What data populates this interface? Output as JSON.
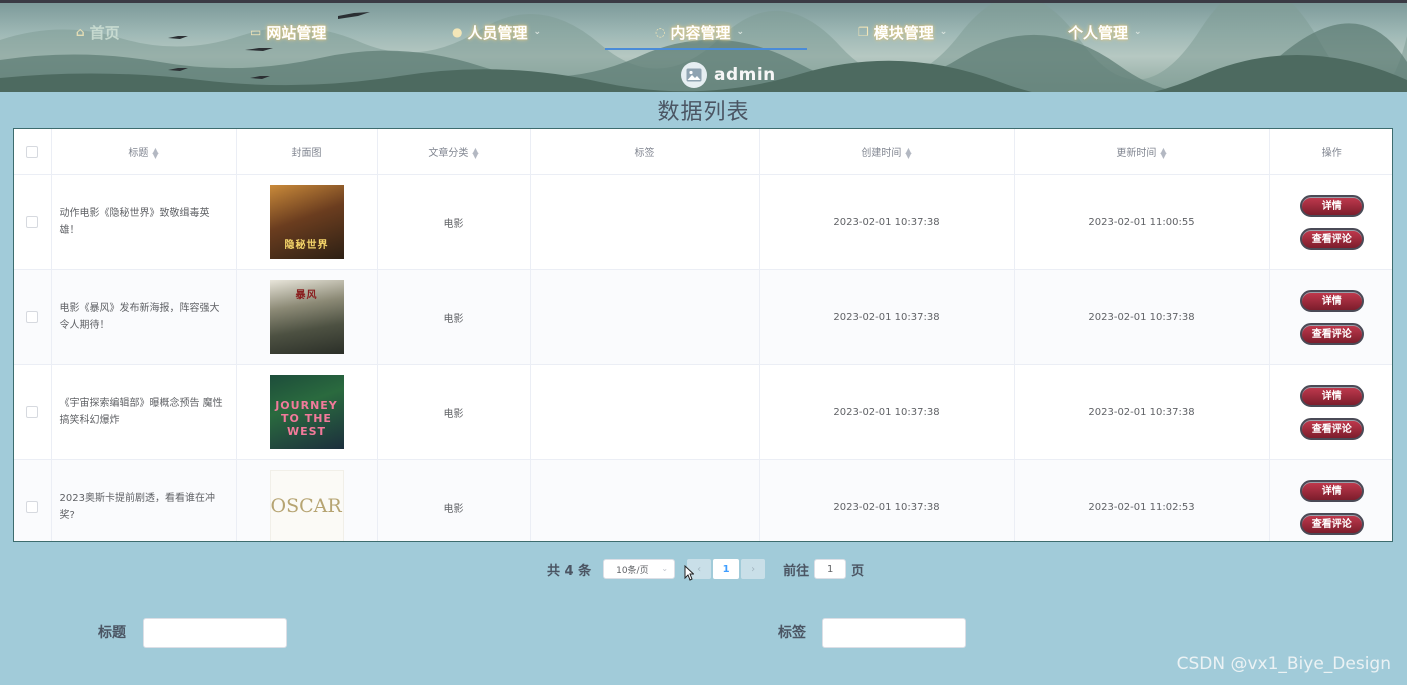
{
  "header": {
    "nav": [
      {
        "label": "首页",
        "icon": "home-icon",
        "caret": false
      },
      {
        "label": "网站管理",
        "icon": "monitor-icon",
        "caret": false
      },
      {
        "label": "人员管理",
        "icon": "user-icon",
        "caret": true
      },
      {
        "label": "内容管理",
        "icon": "chat-icon",
        "caret": true
      },
      {
        "label": "模块管理",
        "icon": "copy-icon",
        "caret": true
      },
      {
        "label": "个人管理",
        "icon": "",
        "caret": true
      }
    ],
    "active_index": 3,
    "user_name": "admin"
  },
  "page_title": "数据列表",
  "table": {
    "columns": [
      "",
      "标题",
      "封面图",
      "文章分类",
      "标签",
      "创建时间",
      "更新时间",
      "操作"
    ],
    "sortable": [
      false,
      true,
      false,
      true,
      false,
      true,
      true,
      false
    ],
    "rows": [
      {
        "title": "动作电影《隐秘世界》致敬缉毒英雄！",
        "cover_text": "隐秘世界",
        "category": "电影",
        "tags": "",
        "created": "2023-02-01 10:37:38",
        "updated": "2023-02-01 11:00:55"
      },
      {
        "title": "电影《暴风》发布新海报，阵容强大令人期待！",
        "cover_text": "暴风",
        "category": "电影",
        "tags": "",
        "created": "2023-02-01 10:37:38",
        "updated": "2023-02-01 10:37:38"
      },
      {
        "title": "《宇宙探索编辑部》曝概念预告 魔性搞笑科幻爆炸",
        "cover_text": "JOURNEY TO THE WEST",
        "category": "电影",
        "tags": "",
        "created": "2023-02-01 10:37:38",
        "updated": "2023-02-01 10:37:38"
      },
      {
        "title": "2023奥斯卡提前剧透，看看谁在冲奖?",
        "cover_text": "OSCARS",
        "category": "电影",
        "tags": "",
        "created": "2023-02-01 10:37:38",
        "updated": "2023-02-01 11:02:53"
      }
    ],
    "action_detail": "详情",
    "action_comments": "查看评论"
  },
  "pagination": {
    "total": "共 4 条",
    "page_size": "10条/页",
    "current_page": "1",
    "goto_prefix": "前往",
    "goto_value": "1",
    "goto_suffix": "页"
  },
  "search": {
    "title_label": "标题",
    "tag_label": "标签"
  },
  "watermark": "CSDN @vx1_Biye_Design",
  "colors": {
    "background": "#a1cbd9",
    "nav_underline": "#4a8bd8",
    "button": "#a52a3d",
    "table_border": "#3d6c6e"
  }
}
